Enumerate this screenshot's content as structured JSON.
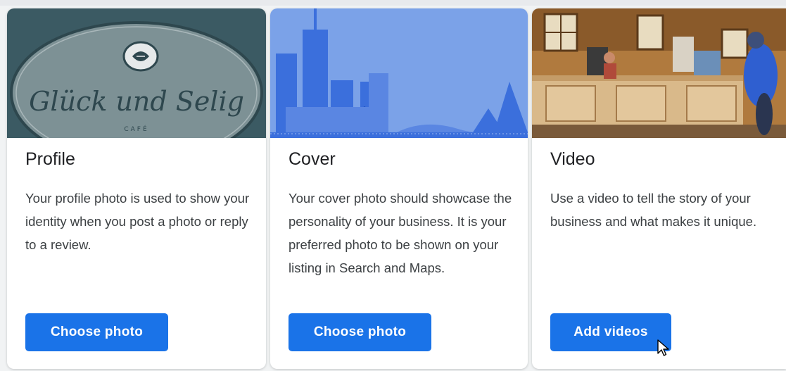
{
  "colors": {
    "accent": "#1a73e8",
    "cover_background": "#7ba2e8",
    "profile_background": "#3b5a63"
  },
  "cards": [
    {
      "title": "Profile",
      "description": "Your profile photo is used to show your identity when you post a photo or reply to a review.",
      "button_label": "Choose photo",
      "image": {
        "kind": "cafe-logo-photo",
        "logo_text": "Glück und Selig",
        "logo_subtext": "CAFÉ"
      }
    },
    {
      "title": "Cover",
      "description": "Your cover photo should showcase the personality of your business. It is your preferred photo to be shown on your listing in Search and Maps.",
      "button_label": "Choose photo",
      "image": {
        "kind": "city-skyline-illustration"
      }
    },
    {
      "title": "Video",
      "description": "Use a video to tell the story of your business and what makes it unique.",
      "button_label": "Add videos",
      "image": {
        "kind": "shop-interior-photo"
      }
    }
  ],
  "cursor": {
    "icon": "pointer-arrow-icon"
  }
}
